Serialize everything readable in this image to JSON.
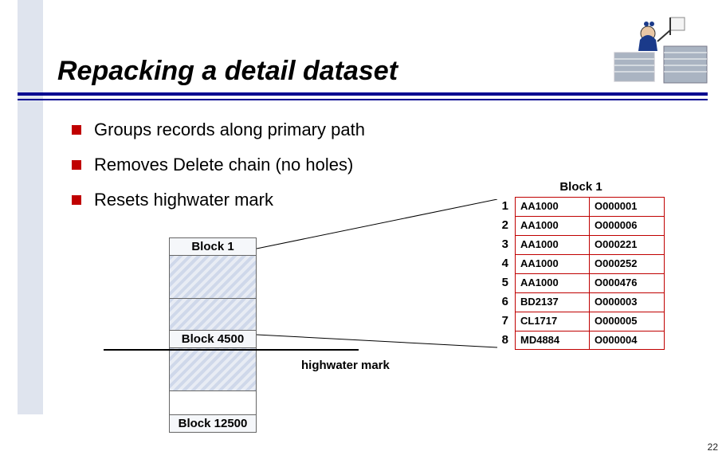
{
  "title": "Repacking a detail dataset",
  "bullets": [
    "Groups records along primary path",
    "Removes Delete chain (no holes)",
    "Resets highwater mark"
  ],
  "blocks": {
    "label_top": "Block 1",
    "label_mid": "Block 4500",
    "label_bottom": "Block 12500"
  },
  "highwater_label": "highwater mark",
  "table": {
    "title": "Block 1",
    "rows": [
      {
        "n": "1",
        "a": "AA1000",
        "b": "O000001"
      },
      {
        "n": "2",
        "a": "AA1000",
        "b": "O000006"
      },
      {
        "n": "3",
        "a": "AA1000",
        "b": "O000221"
      },
      {
        "n": "4",
        "a": "AA1000",
        "b": "O000252"
      },
      {
        "n": "5",
        "a": "AA1000",
        "b": "O000476"
      },
      {
        "n": "6",
        "a": "BD2137",
        "b": "O000003"
      },
      {
        "n": "7",
        "a": "CL1717",
        "b": "O000005"
      },
      {
        "n": "8",
        "a": "MD4884",
        "b": "O000004"
      }
    ]
  },
  "page_number": "22"
}
